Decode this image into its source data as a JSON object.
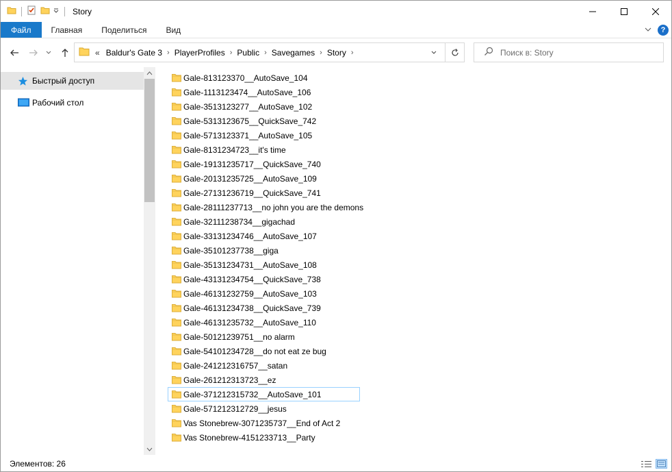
{
  "window": {
    "title": "Story"
  },
  "ribbon": {
    "tabs": [
      "Файл",
      "Главная",
      "Поделиться",
      "Вид"
    ],
    "help": "?"
  },
  "address": {
    "prefix": "«",
    "crumbs": [
      "Baldur's Gate 3",
      "PlayerProfiles",
      "Public",
      "Savegames",
      "Story"
    ]
  },
  "search": {
    "placeholder": "Поиск в: Story"
  },
  "navpane": {
    "items": [
      {
        "label": "Быстрый доступ",
        "icon": "star-icon",
        "selected": true
      },
      {
        "label": "Рабочий стол",
        "icon": "desktop-icon",
        "selected": false
      }
    ]
  },
  "files": [
    "Gale-813123370__AutoSave_104",
    "Gale-1113123474__AutoSave_106",
    "Gale-3513123277__AutoSave_102",
    "Gale-5313123675__QuickSave_742",
    "Gale-5713123371__AutoSave_105",
    "Gale-8131234723__it's time",
    "Gale-19131235717__QuickSave_740",
    "Gale-20131235725__AutoSave_109",
    "Gale-27131236719__QuickSave_741",
    "Gale-28111237713__no john you are the demons",
    "Gale-32111238734__gigachad",
    "Gale-33131234746__AutoSave_107",
    "Gale-35101237738__giga",
    "Gale-35131234731__AutoSave_108",
    "Gale-43131234754__QuickSave_738",
    "Gale-46131232759__AutoSave_103",
    "Gale-46131234738__QuickSave_739",
    "Gale-46131235732__AutoSave_110",
    "Gale-50121239751__no alarm",
    "Gale-54101234728__do not eat ze bug",
    "Gale-241212316757__satan",
    "Gale-261212313723__ez",
    "Gale-371212315732__AutoSave_101",
    "Gale-571212312729__jesus",
    "Vas Stonebrew-3071235737__End of Act 2",
    "Vas Stonebrew-4151233713__Party"
  ],
  "focused_index": 22,
  "status": {
    "count_label": "Элементов: 26"
  },
  "colors": {
    "accent": "#1979ca",
    "folder": "#ffd35c",
    "selection": "#99d1ff"
  }
}
